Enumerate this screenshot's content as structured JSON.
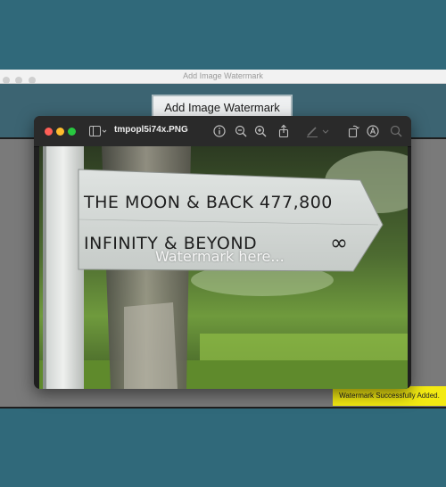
{
  "app": {
    "title": "Add Image Watermark",
    "button_label": "Add Image Watermark",
    "status_message": "Watermark Successfully Added."
  },
  "preview": {
    "file_name": "tmpopl5i74x.PNG",
    "watermark_text": "Watermark here...",
    "sign_line_1": "THE MOON & BACK 477,800",
    "sign_line_2": "INFINITY & BEYOND",
    "sign_symbol": "∞",
    "toolbar_icons": [
      "sidebar-icon",
      "info-icon",
      "zoom-out-icon",
      "zoom-in-icon",
      "share-icon",
      "markup-pen-icon",
      "rotate-icon",
      "annotate-icon",
      "search-icon"
    ]
  },
  "colors": {
    "background": "#30697a",
    "banner": "#f3ea12",
    "traffic_red": "#ff5f57",
    "traffic_yellow": "#febc2e",
    "traffic_green": "#28c840"
  }
}
